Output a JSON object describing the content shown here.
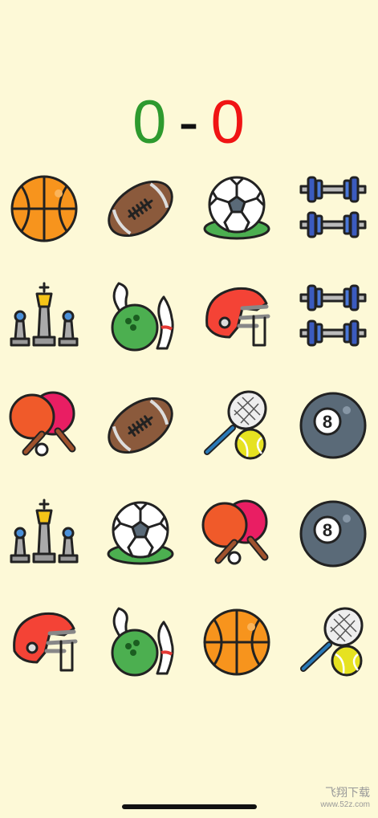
{
  "score": {
    "player1": "0",
    "separator": "-",
    "player2": "0"
  },
  "colors": {
    "background": "#fdf9d7",
    "player1": "#2e9a2e",
    "player2": "#f01414"
  },
  "board": {
    "rows": [
      [
        "basketball-icon",
        "football-icon",
        "soccer-ball-icon",
        "dumbbell-icon"
      ],
      [
        "chess-icon",
        "bowling-icon",
        "football-helmet-icon",
        "dumbbell-icon"
      ],
      [
        "ping-pong-icon",
        "football-icon",
        "tennis-icon",
        "eight-ball-icon"
      ],
      [
        "chess-icon",
        "soccer-ball-icon",
        "ping-pong-icon",
        "eight-ball-icon"
      ],
      [
        "football-helmet-icon",
        "bowling-icon",
        "basketball-icon",
        "tennis-icon"
      ]
    ]
  },
  "watermark": {
    "text": "飞翔下载",
    "site": "www.52z.com"
  }
}
